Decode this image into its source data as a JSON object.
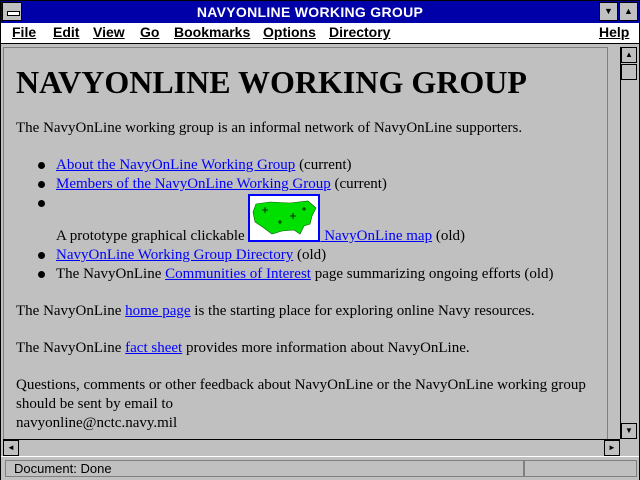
{
  "window": {
    "title": "NAVYONLINE WORKING GROUP"
  },
  "menu": [
    "File",
    "Edit",
    "View",
    "Go",
    "Bookmarks",
    "Options",
    "Directory",
    "Help"
  ],
  "page": {
    "heading": "NAVYONLINE WORKING GROUP",
    "intro": "The NavyOnLine working group is an informal network of NavyOnLine supporters.",
    "list": [
      {
        "link": "About the NavyOnLine Working Group",
        "after": " (current)"
      },
      {
        "link": "Members of the NavyOnLine Working Group",
        "after": " (current)"
      },
      {
        "before": "A prototype graphical clickable ",
        "link": " NavyOnLine map",
        "after": " (old)"
      },
      {
        "link": "NavyOnLine Working Group Directory",
        "after": " (old)"
      },
      {
        "before": "The NavyOnLine ",
        "link": "Communities of Interest",
        "after": " page summarizing ongoing efforts (old)"
      }
    ],
    "home": {
      "before": "The NavyOnLine ",
      "link": "home page",
      "after": " is the starting place for exploring online Navy resources."
    },
    "fact": {
      "before": "The NavyOnLine ",
      "link": "fact sheet",
      "after": " provides more information about NavyOnLine."
    },
    "feedback": "Questions, comments or other feedback about NavyOnLine or the NavyOnLine working group should be sent by email to",
    "email": "navyonline@nctc.navy.mil"
  },
  "status": {
    "text": "Document: Done",
    "progress_fraction": 0
  },
  "colors": {
    "title_bar": "#0000a8",
    "link": "#0000ff",
    "map_land": "#00e000",
    "background": "#c0c0c0"
  },
  "icons": [
    "system-menu-icon",
    "minimize-arrow-icon",
    "maximize-arrow-icon",
    "scroll-up-arrow-icon",
    "scroll-down-arrow-icon",
    "scroll-left-arrow-icon",
    "scroll-right-arrow-icon"
  ]
}
